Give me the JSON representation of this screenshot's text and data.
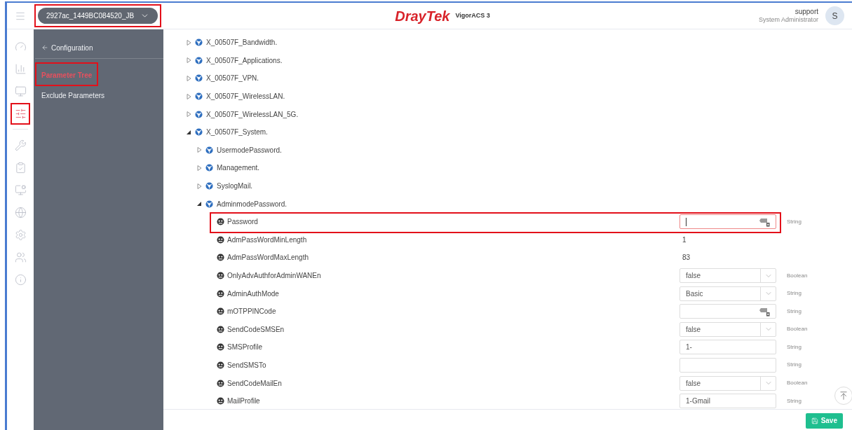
{
  "device_selector": {
    "label": "2927ac_1449BC084520_JB",
    "highlighted": true
  },
  "brand": {
    "logo": "DrayTek",
    "product": "VigorACS 3"
  },
  "user": {
    "name": "support",
    "role": "System Administrator",
    "avatar": "S"
  },
  "rail": [
    {
      "selected": false,
      "highlighted": false
    },
    {
      "selected": false,
      "highlighted": false
    },
    {
      "selected": false,
      "highlighted": false
    },
    {
      "selected": true,
      "highlighted": true
    },
    {
      "selected": false,
      "highlighted": false
    },
    {
      "selected": false,
      "highlighted": false
    },
    {
      "selected": false,
      "highlighted": false
    },
    {
      "selected": false,
      "highlighted": false
    },
    {
      "selected": false,
      "highlighted": false
    },
    {
      "selected": false,
      "highlighted": false
    },
    {
      "selected": false,
      "highlighted": false
    }
  ],
  "submenu": {
    "back": "Configuration",
    "items": [
      {
        "label": "Parameter Tree",
        "selected": true,
        "highlighted": true
      },
      {
        "label": "Exclude Parameters",
        "selected": false,
        "highlighted": false
      }
    ]
  },
  "tree": [
    {
      "label": "X_00507F_Bandwidth.",
      "expanded": false
    },
    {
      "label": "X_00507F_Applications.",
      "expanded": false
    },
    {
      "label": "X_00507F_VPN.",
      "expanded": false
    },
    {
      "label": "X_00507F_WirelessLAN.",
      "expanded": false
    },
    {
      "label": "X_00507F_WirelessLAN_5G.",
      "expanded": false
    },
    {
      "label": "X_00507F_System.",
      "expanded": true,
      "children": [
        {
          "label": "UsermodePassword.",
          "expanded": false
        },
        {
          "label": "Management.",
          "expanded": false
        },
        {
          "label": "SyslogMail.",
          "expanded": false
        },
        {
          "label": "AdminmodePassword.",
          "expanded": true,
          "parameters": [
            {
              "name": "Password",
              "kind": "secret",
              "type": "String",
              "focused": true,
              "highlighted": true
            },
            {
              "name": "AdmPassWordMinLength",
              "kind": "text",
              "value": "1",
              "highlighted": false
            },
            {
              "name": "AdmPassWordMaxLength",
              "kind": "text",
              "value": "83",
              "highlighted": false
            },
            {
              "name": "OnlyAdvAuthforAdminWANEn",
              "kind": "select",
              "value": "false",
              "type": "Boolean",
              "focused": false,
              "highlighted": false
            },
            {
              "name": "AdminAuthMode",
              "kind": "select",
              "value": "Basic",
              "type": "String",
              "focused": false,
              "highlighted": false
            },
            {
              "name": "mOTPPINCode",
              "kind": "secret",
              "type": "String",
              "focused": false,
              "highlighted": false
            },
            {
              "name": "SendCodeSMSEn",
              "kind": "select",
              "value": "false",
              "type": "Boolean",
              "focused": false,
              "highlighted": false
            },
            {
              "name": "SMSProfile",
              "kind": "input",
              "value": "1-",
              "type": "String",
              "focused": false,
              "highlighted": false
            },
            {
              "name": "SendSMSTo",
              "kind": "input",
              "type": "String",
              "focused": false,
              "highlighted": false
            },
            {
              "name": "SendCodeMailEn",
              "kind": "select",
              "value": "false",
              "type": "Boolean",
              "focused": false,
              "highlighted": false
            },
            {
              "name": "MailProfile",
              "kind": "input",
              "value": "1-Gmail",
              "type": "String",
              "focused": false,
              "highlighted": false
            }
          ]
        }
      ]
    }
  ],
  "save_button": "Save"
}
